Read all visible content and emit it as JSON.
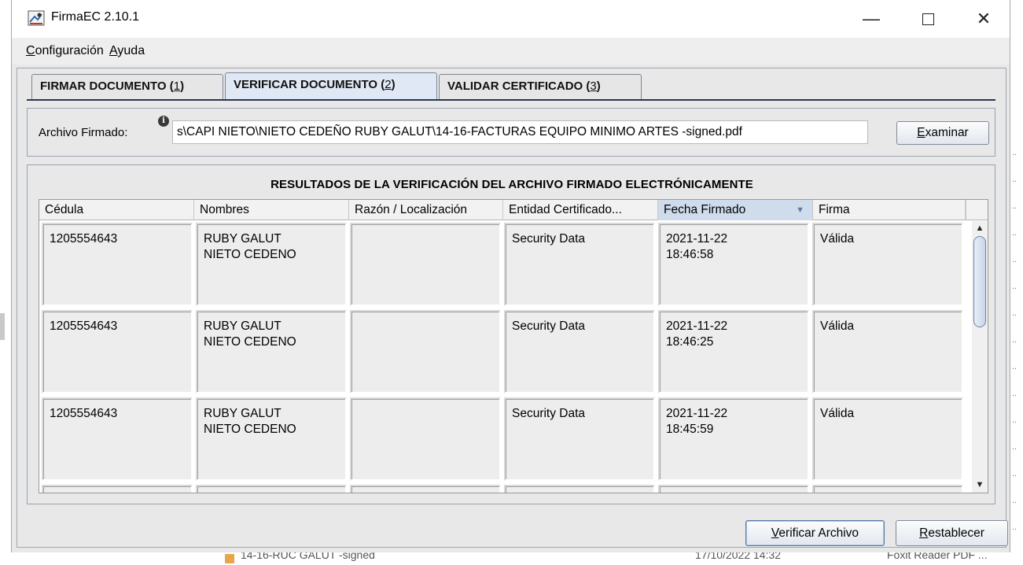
{
  "window": {
    "title": "FirmaEC 2.10.1",
    "controls": {
      "minimize": "—",
      "close": "✕"
    }
  },
  "menu": [
    {
      "underline": "C",
      "rest": "onfiguración"
    },
    {
      "underline": "A",
      "rest": "yuda"
    }
  ],
  "tabs": [
    {
      "label": "FIRMAR DOCUMENTO ",
      "key": "1",
      "active": false
    },
    {
      "label": "VERIFICAR DOCUMENTO ",
      "key": "2",
      "active": true
    },
    {
      "label": "VALIDAR CERTIFICADO ",
      "key": "3",
      "active": false
    }
  ],
  "file": {
    "label": "Archivo Firmado:",
    "info_icon": "i",
    "value": "s\\CAPI NIETO\\NIETO CEDEÑO RUBY GALUT\\14-16-FACTURAS EQUIPO MINIMO ARTES -signed.pdf",
    "browse": {
      "underline": "E",
      "rest": "xaminar"
    }
  },
  "results": {
    "title": "RESULTADOS DE LA VERIFICACIÓN DEL ARCHIVO FIRMADO ELECTRÓNICAMENTE",
    "columns": [
      "Cédula",
      "Nombres",
      "Razón / Localización",
      "Entidad Certificado...",
      "Fecha Firmado",
      "Firma"
    ],
    "sort_icon": "▼",
    "rows": [
      {
        "cedula": "1205554643",
        "nombres": "RUBY GALUT\nNIETO CEDENO",
        "razon": "",
        "entidad": "Security Data",
        "fecha": "2021-11-22\n18:46:58",
        "firma": "Válida"
      },
      {
        "cedula": "1205554643",
        "nombres": "RUBY GALUT\nNIETO CEDENO",
        "razon": "",
        "entidad": "Security Data",
        "fecha": "2021-11-22\n18:46:25",
        "firma": "Válida"
      },
      {
        "cedula": "1205554643",
        "nombres": "RUBY GALUT\nNIETO CEDENO",
        "razon": "",
        "entidad": "Security Data",
        "fecha": "2021-11-22\n18:45:59",
        "firma": "Válida"
      }
    ],
    "scroll": {
      "up": "▲",
      "down": "▼"
    }
  },
  "buttons": {
    "verify": {
      "underline": "V",
      "rest": "erificar Archivo"
    },
    "reset": {
      "underline": "R",
      "rest": "establecer"
    }
  },
  "background": {
    "bottom_file": "14-16-RUC GALUT -signed",
    "bottom_date": "17/10/2022 14:32",
    "bottom_app": "Foxit Reader PDF ...",
    "dots": ".."
  }
}
